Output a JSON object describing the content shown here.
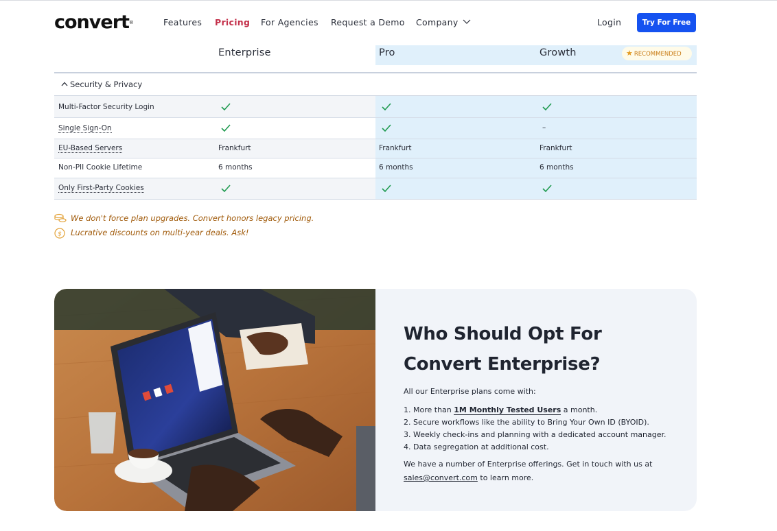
{
  "nav": {
    "logo": "convert",
    "logo_mark": "®",
    "links": [
      "Features",
      "Pricing",
      "For Agencies",
      "Request a Demo",
      "Company"
    ],
    "active_link": "Pricing",
    "login": "Login",
    "cta": "Try For Free"
  },
  "plans": {
    "enterprise": "Enterprise",
    "pro": "Pro",
    "growth": "Growth",
    "badge": "RECOMMENDED"
  },
  "section": {
    "title": "Security & Privacy",
    "rows": [
      {
        "label": "Multi-Factor Security Login",
        "enterprise": "check",
        "pro": "check",
        "growth": "check"
      },
      {
        "label": "Single Sign-On",
        "enterprise": "check",
        "pro": "check",
        "growth": "–"
      },
      {
        "label": "EU-Based Servers",
        "enterprise": "Frankfurt",
        "pro": "Frankfurt",
        "growth": "Frankfurt"
      },
      {
        "label": "Non-PII Cookie Lifetime",
        "enterprise": "6 months",
        "pro": "6 months",
        "growth": "6 months"
      },
      {
        "label": "Only First-Party Cookies",
        "enterprise": "check",
        "pro": "check",
        "growth": "check"
      }
    ]
  },
  "notes": [
    "We don't force plan upgrades. Convert honors legacy pricing.",
    "Lucrative discounts on multi-year deals. Ask!"
  ],
  "enterprise_card": {
    "title": "Who Should Opt For Convert Enterprise?",
    "intro": "All our Enterprise plans come with:",
    "item1_pre": "1. More than ",
    "item1_bold": "1M Monthly Tested Users",
    "item1_post": " a month.",
    "item2": "2. Secure workflows like the ability to Bring Your Own ID (BYOID).",
    "item3": "3. Weekly check-ins and planning with a dedicated account manager.",
    "item4": "4. Data segregation at additional cost.",
    "footer_pre": "We have a number of Enterprise offerings. Get in touch with us at",
    "footer_email": "sales@convert.com",
    "footer_post": " to learn more."
  },
  "colors": {
    "accent": "#1552f0",
    "active_nav": "#c4314b",
    "check": "#1e9a4f",
    "highlight_column": "#e0f0fb",
    "note_text": "#a05a0a"
  }
}
